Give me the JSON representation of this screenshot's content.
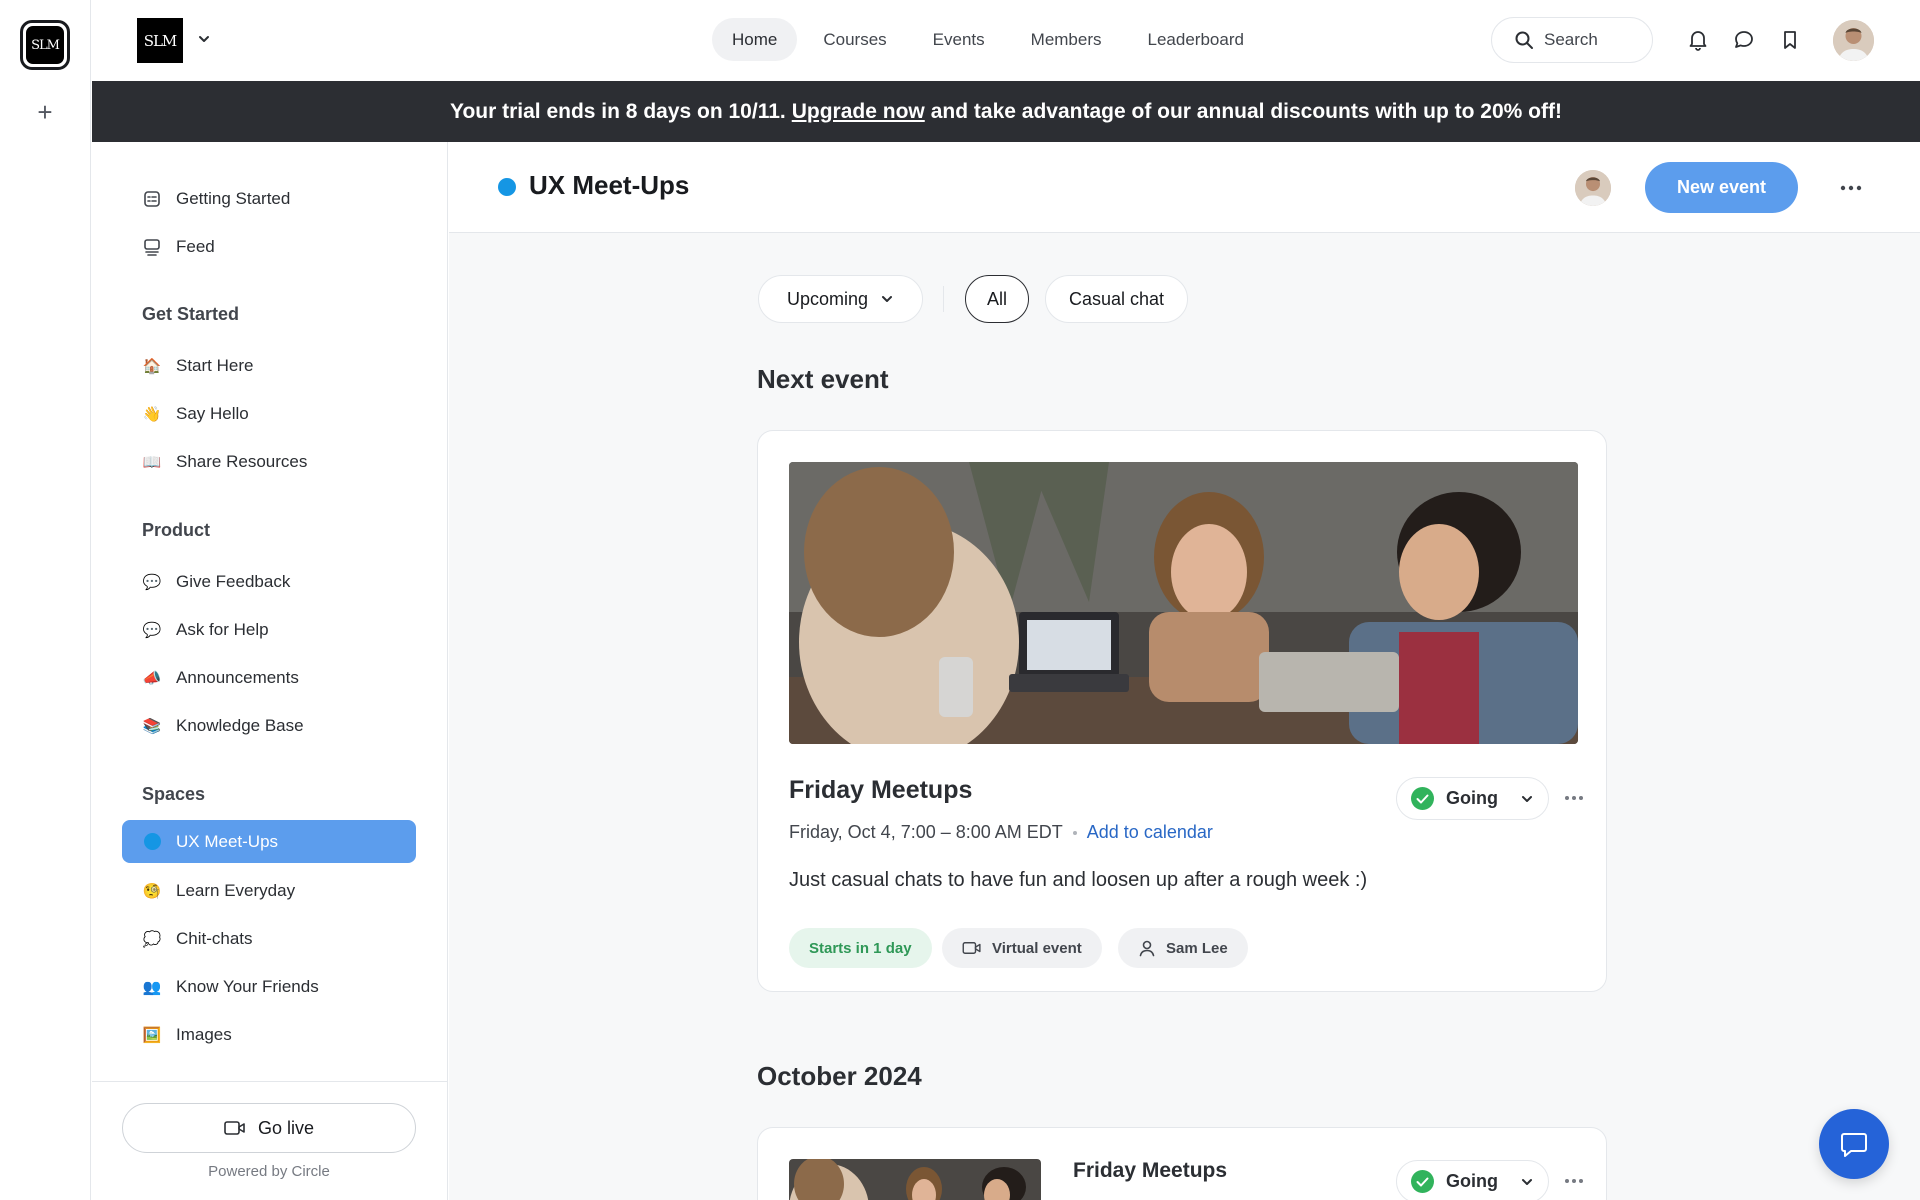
{
  "rail": {
    "logo_text": "SLM",
    "add_label": "+"
  },
  "header": {
    "brand_text": "SLM",
    "nav": [
      {
        "label": "Home",
        "active": true
      },
      {
        "label": "Courses"
      },
      {
        "label": "Events"
      },
      {
        "label": "Members"
      },
      {
        "label": "Leaderboard"
      }
    ],
    "search_label": "Search"
  },
  "banner": {
    "text_before": "Your trial ends in 8 days on 10/11.",
    "link": "Upgrade now",
    "text_after": "and take advantage of our annual discounts with up to 20% off!"
  },
  "sidebar": {
    "top_items": [
      {
        "label": "Getting Started",
        "icon": "checklist-icon"
      },
      {
        "label": "Feed",
        "icon": "feed-icon"
      }
    ],
    "groups": [
      {
        "title": "Get Started",
        "items": [
          {
            "emoji": "🏠",
            "label": "Start Here"
          },
          {
            "emoji": "👋",
            "label": "Say Hello"
          },
          {
            "emoji": "📖",
            "label": "Share Resources"
          }
        ]
      },
      {
        "title": "Product",
        "items": [
          {
            "emoji": "💬",
            "label": "Give Feedback"
          },
          {
            "emoji": "💬",
            "label": "Ask for Help"
          },
          {
            "emoji": "📣",
            "label": "Announcements"
          },
          {
            "emoji": "📚",
            "label": "Knowledge Base"
          }
        ]
      },
      {
        "title": "Spaces",
        "items": [
          {
            "emoji": "",
            "label": "UX Meet-Ups",
            "active": true
          },
          {
            "emoji": "🧐",
            "label": "Learn Everyday"
          },
          {
            "emoji": "💭",
            "label": "Chit-chats"
          },
          {
            "emoji": "👥",
            "label": "Know Your Friends"
          },
          {
            "emoji": "🖼️",
            "label": "Images"
          }
        ]
      }
    ],
    "go_live": "Go live",
    "powered_by": "Powered by Circle"
  },
  "space": {
    "title": "UX Meet-Ups",
    "dot_color": "#1596e4",
    "new_event": "New event"
  },
  "filters": {
    "upcoming": "Upcoming",
    "all": "All",
    "casual": "Casual chat"
  },
  "next_event": {
    "section_title": "Next event",
    "name": "Friday Meetups",
    "datetime": "Friday, Oct 4, 7:00 – 8:00 AM EDT",
    "add_to_calendar": "Add to calendar",
    "description": "Just casual chats to have fun and loosen up after a rough week :)",
    "rsvp": "Going",
    "tags": {
      "starts": "Starts in 1 day",
      "virtual": "Virtual event",
      "host": "Sam Lee"
    }
  },
  "month": {
    "section_title": "October 2024",
    "event_name": "Friday Meetups",
    "rsvp": "Going"
  },
  "colors": {
    "accent": "#5c9ded",
    "banner": "#2c2e33",
    "going_check": "#31b35c",
    "link": "#2867c5",
    "chat_fab": "#2563d8"
  }
}
